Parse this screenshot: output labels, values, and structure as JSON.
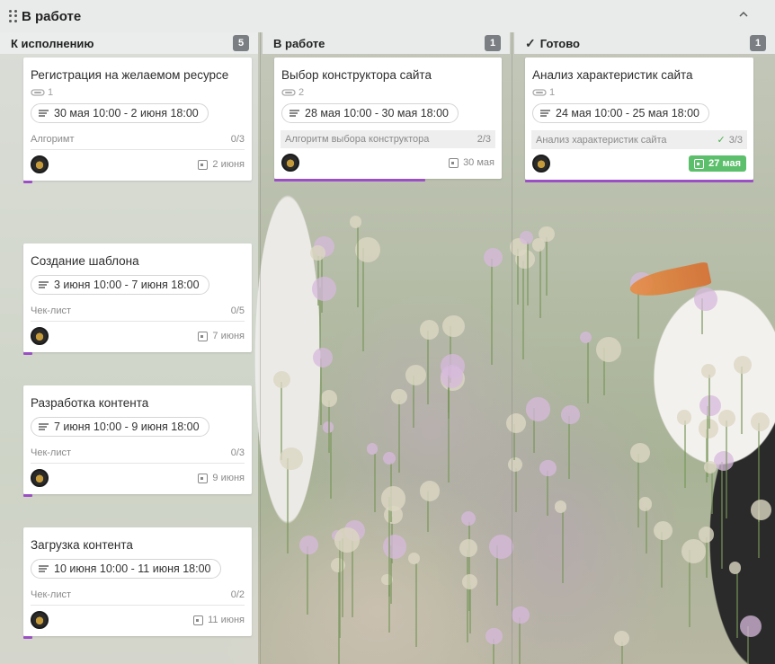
{
  "group": {
    "title": "В работе"
  },
  "columns": [
    {
      "title": "К исполнению",
      "count": "5",
      "cards": [
        {
          "title": "Регистрация на желаемом ресурсе",
          "attachments": "1",
          "date": "30 мая 10:00 - 2 июня 18:00",
          "checklist": "Алгоримт",
          "progress": "0/3",
          "due": "2 июня"
        },
        {
          "title": "Создание шаблона",
          "date": "3 июня 10:00 - 7 июня 18:00",
          "checklist": "Чек-лист",
          "progress": "0/5",
          "due": "7 июня"
        },
        {
          "title": "Разработка контента",
          "date": "7 июня 10:00 - 9 июня 18:00",
          "checklist": "Чек-лист",
          "progress": "0/3",
          "due": "9 июня"
        },
        {
          "title": "Загрузка контента",
          "date": "10 июня 10:00 - 11 июня 18:00",
          "checklist": "Чек-лист",
          "progress": "0/2",
          "due": "11 июня"
        }
      ]
    },
    {
      "title": "В работе",
      "count": "1",
      "cards": [
        {
          "title": "Выбор конструктора сайта",
          "attachments": "2",
          "date": "28 мая 10:00 - 30 мая 18:00",
          "checklist": "Алгоритм выбора конструктора",
          "progress": "2/3",
          "due": "30 мая"
        }
      ]
    },
    {
      "title": "Готово",
      "count": "1",
      "cards": [
        {
          "title": "Анализ характеристик сайта",
          "attachments": "1",
          "date": "24 мая 10:00 - 25 мая 18:00",
          "checklist": "Анализ характеристик сайта",
          "progress": "3/3",
          "due": "27 мая"
        }
      ]
    }
  ],
  "colors": {
    "accent_bar": "#9b4fc4",
    "done_green": "#5cbf6b",
    "count_badge": "#7b7f84"
  },
  "icons": {
    "drag": "drag-handle-icon",
    "collapse": "chevron-up-icon",
    "attach": "paperclip-icon",
    "date": "description-lines-icon",
    "calendar": "calendar-icon",
    "check": "check-icon"
  }
}
